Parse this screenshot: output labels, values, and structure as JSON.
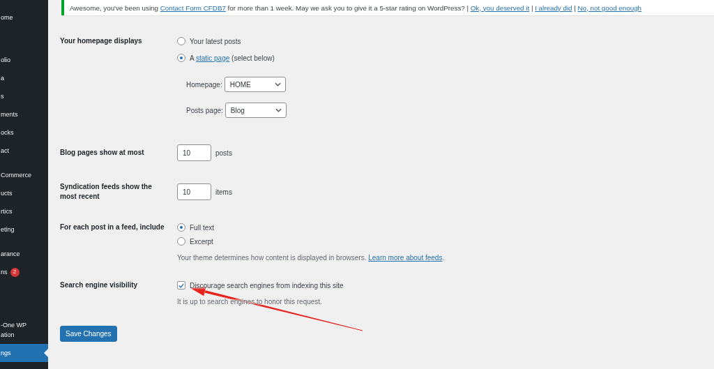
{
  "sidebar": {
    "groups": [
      {
        "items": [
          {
            "label": "ome",
            "selected": false
          }
        ]
      },
      {
        "items": [
          {
            "label": "olio",
            "selected": false
          },
          {
            "label": "a",
            "selected": false
          },
          {
            "label": "s",
            "selected": false
          },
          {
            "label": "ments",
            "selected": false
          },
          {
            "label": "ocks",
            "selected": false
          },
          {
            "label": "act",
            "selected": false
          }
        ]
      },
      {
        "items": [
          {
            "label": "Commerce",
            "selected": false
          },
          {
            "label": "ucts",
            "selected": false
          },
          {
            "label": "rtics",
            "selected": false
          },
          {
            "label": "eting",
            "selected": false
          }
        ]
      },
      {
        "items": [
          {
            "label": "arance",
            "selected": false
          },
          {
            "label": "ns",
            "badge": "2",
            "selected": false
          }
        ]
      },
      {
        "items": [
          {
            "label": "-One WP\nation",
            "selected": false
          },
          {
            "label": "ngs",
            "selected": true
          }
        ]
      }
    ]
  },
  "notice": {
    "text": "Awesome, you've been using ",
    "link": "Contact Form CFDB7",
    "text_after": " for more than 1 week. May we ask you to give it a 5-star rating on WordPress?",
    "separator": "|",
    "actions": [
      "Ok, you deserved it",
      "I already did",
      "No, not good enough"
    ]
  },
  "settings": [
    {
      "kind": "radio",
      "label": "Your homepage displays",
      "options": [
        {
          "label": "Your latest posts",
          "selected": false
        },
        {
          "label": "A ",
          "link": "static page",
          "label_after": " (select below)",
          "selected": true
        }
      ],
      "selects": [
        {
          "label": "Homepage:",
          "value": "HOME"
        },
        {
          "label": "Posts page:",
          "value": "Blog"
        }
      ]
    },
    {
      "kind": "number",
      "label": "Blog pages show at most",
      "value": "10",
      "unit": "posts"
    },
    {
      "kind": "number",
      "label": "Syndication feeds show the most recent",
      "value": "10",
      "unit": "items"
    },
    {
      "kind": "radio",
      "label": "For each post in a feed, include",
      "options": [
        {
          "label": "Full text",
          "selected": true
        },
        {
          "label": "Excerpt",
          "selected": false
        }
      ],
      "description": {
        "text": "Your theme determines how content is displayed in browsers. ",
        "link": "Learn more about feeds",
        "text_after": "."
      }
    },
    {
      "kind": "checkbox",
      "label": "Search engine visibility",
      "option": {
        "label": "Discourage search engines from indexing this site",
        "checked": true
      },
      "description": {
        "text": "It is up to search engines to honor this request."
      }
    }
  ],
  "submit": {
    "label": "Save Changes"
  }
}
